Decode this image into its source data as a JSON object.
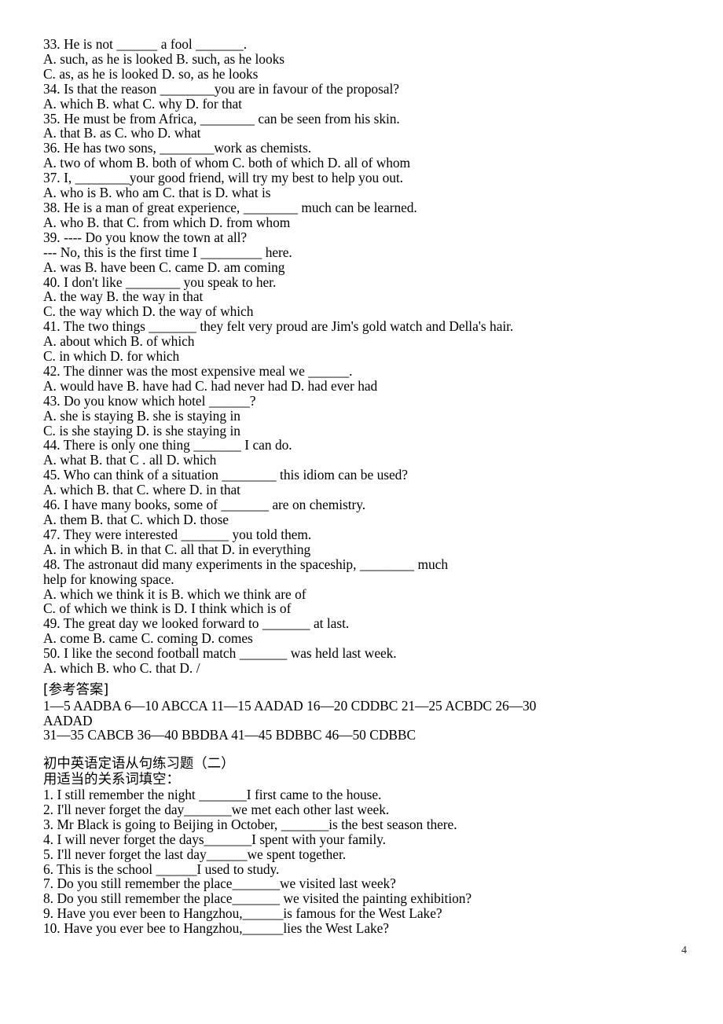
{
  "document": {
    "page_number": "4",
    "title": "初中英语定语从句练习题（二）"
  },
  "multiple_choice": {
    "lines": [
      "33. He is not ______ a fool _______.",
      "A. such, as he is looked B. such, as he looks",
      "C. as, as he is looked D. so, as he looks",
      "34. Is that the reason ________you are in favour of the proposal?",
      "A. which B. what C. why D. for that",
      "35. He must be from Africa, ________ can be seen from his skin.",
      "A. that B. as C. who D. what",
      "36. He has two sons, ________work as chemists.",
      "A. two of whom B. both of whom C. both of which D. all of whom",
      "37. I, ________your good friend, will try my best to help you out.",
      "A. who is B. who am C. that is D. what is",
      "38. He is a man of great experience, ________ much can be learned.",
      "A. who B. that C. from which D. from whom",
      "39. ---- Do you know the town at all?",
      "--- No, this is the first time I _________ here.",
      "A. was B. have been C. came D. am coming",
      "40. I don't like ________ you speak to her.",
      "A. the way B. the way in that",
      "C. the way which D. the way of which",
      "41. The two things _______ they felt very proud are Jim's gold watch and Della's hair.",
      "A. about which B. of which",
      "C. in which D. for which",
      "42. The dinner was the most expensive meal we ______.",
      "A. would have B. have had C. had never had D. had ever had",
      "43. Do you know which hotel ______?",
      "A. she is staying B. she is staying in",
      "C. is she staying D. is she staying in",
      "44. There is only one thing _______ I can do.",
      "A. what B. that C . all D. which",
      "45. Who can think of a situation ________ this idiom can be used?",
      "A. which B. that C. where D. in that",
      "46. I have many books, some of _______ are on chemistry.",
      "A. them B. that C. which D. those",
      "47. They were interested _______ you told them.",
      "A. in which B. in that C. all that D. in everything",
      "48. The astronaut did many experiments in the spaceship, ________ much",
      "help for knowing space.",
      "A. which we think it is B. which we think are of",
      "C. of which we think is D. I think which is of",
      "49. The great day we looked forward to _______ at last.",
      "A. come B. came C. coming D. comes",
      "50. I like the second football match _______ was held last week.",
      "A. which B. who C. that D. /"
    ]
  },
  "answer_key": {
    "heading": "[参考答案]",
    "lines": [
      "1—5 AADBA 6—10 ABCCA 11—15 AADAD 16—20 CDDBC 21—25 ACBDC 26—30",
      "AADAD",
      "31—35 CABCB 36—40 BBDBA 41—45 BDBBC 46—50 CDBBC"
    ]
  },
  "exercise_two": {
    "title": "初中英语定语从句练习题（二）",
    "instruction": "用适当的关系词填空：",
    "items": [
      "1. I still remember the night _______I first came to the house.",
      "2. I'll never forget the day_______we met each other last week.",
      "3. Mr Black is going to Beijing in October, _______is the best season there.",
      "4. I will never forget the days_______I spent with your family.",
      "5. I'll never forget the last day______we spent together.",
      "6. This is the school ______I used to study.",
      "7. Do you still remember the place_______we visited last week?",
      "8. Do you still remember the place_______ we visited the painting exhibition?",
      "9. Have you ever been to Hangzhou,______is famous for the West Lake?",
      "10. Have you ever bee to Hangzhou,______lies the West Lake?"
    ]
  }
}
